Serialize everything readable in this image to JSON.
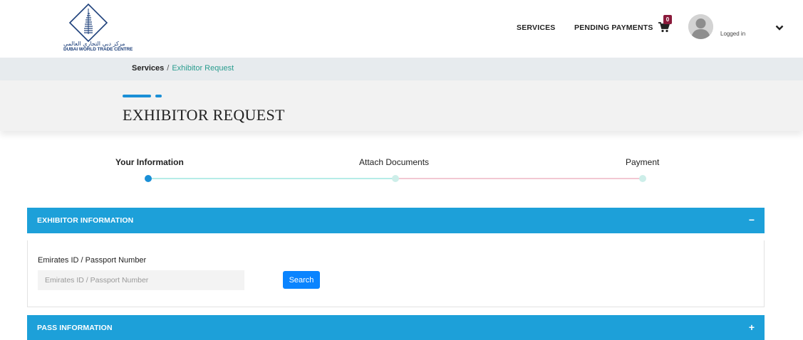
{
  "header": {
    "logo": {
      "arabic": "مركز دبي التجاري العالمي",
      "english": "DUBAI WORLD TRADE CENTRE"
    },
    "nav": {
      "services": "SERVICES",
      "pending_payments": "PENDING PAYMENTS"
    },
    "cart_count": "0",
    "user_status": "Logged in"
  },
  "breadcrumb": {
    "parent": "Services",
    "separator": "/",
    "current": "Exhibitor Request"
  },
  "page_title": "EXHIBITOR REQUEST",
  "stepper": {
    "steps": [
      {
        "label": "Your Information",
        "state": "active"
      },
      {
        "label": "Attach Documents",
        "state": "pending"
      },
      {
        "label": "Payment",
        "state": "pending"
      }
    ]
  },
  "panels": {
    "exhibitor": {
      "title": "EXHIBITOR INFORMATION",
      "toggle": "−",
      "field_label": "Emirates ID / Passport Number",
      "field_placeholder": "Emirates ID / Passport Number",
      "field_value": "",
      "search_label": "Search"
    },
    "pass": {
      "title": "PASS INFORMATION",
      "toggle": "+"
    }
  },
  "colors": {
    "panel_header": "#1da0d9",
    "step_active": "#1a8fd6",
    "track_done": "#b6ece8",
    "track_pending": "#f2c8d3",
    "badge": "#8a1a3b",
    "button": "#0a84ff",
    "breadcrumb_link": "#2a9d8f"
  },
  "icons": {
    "cart": "shopping-cart-icon",
    "user": "user-avatar-icon",
    "chevron": "chevron-down-icon"
  }
}
